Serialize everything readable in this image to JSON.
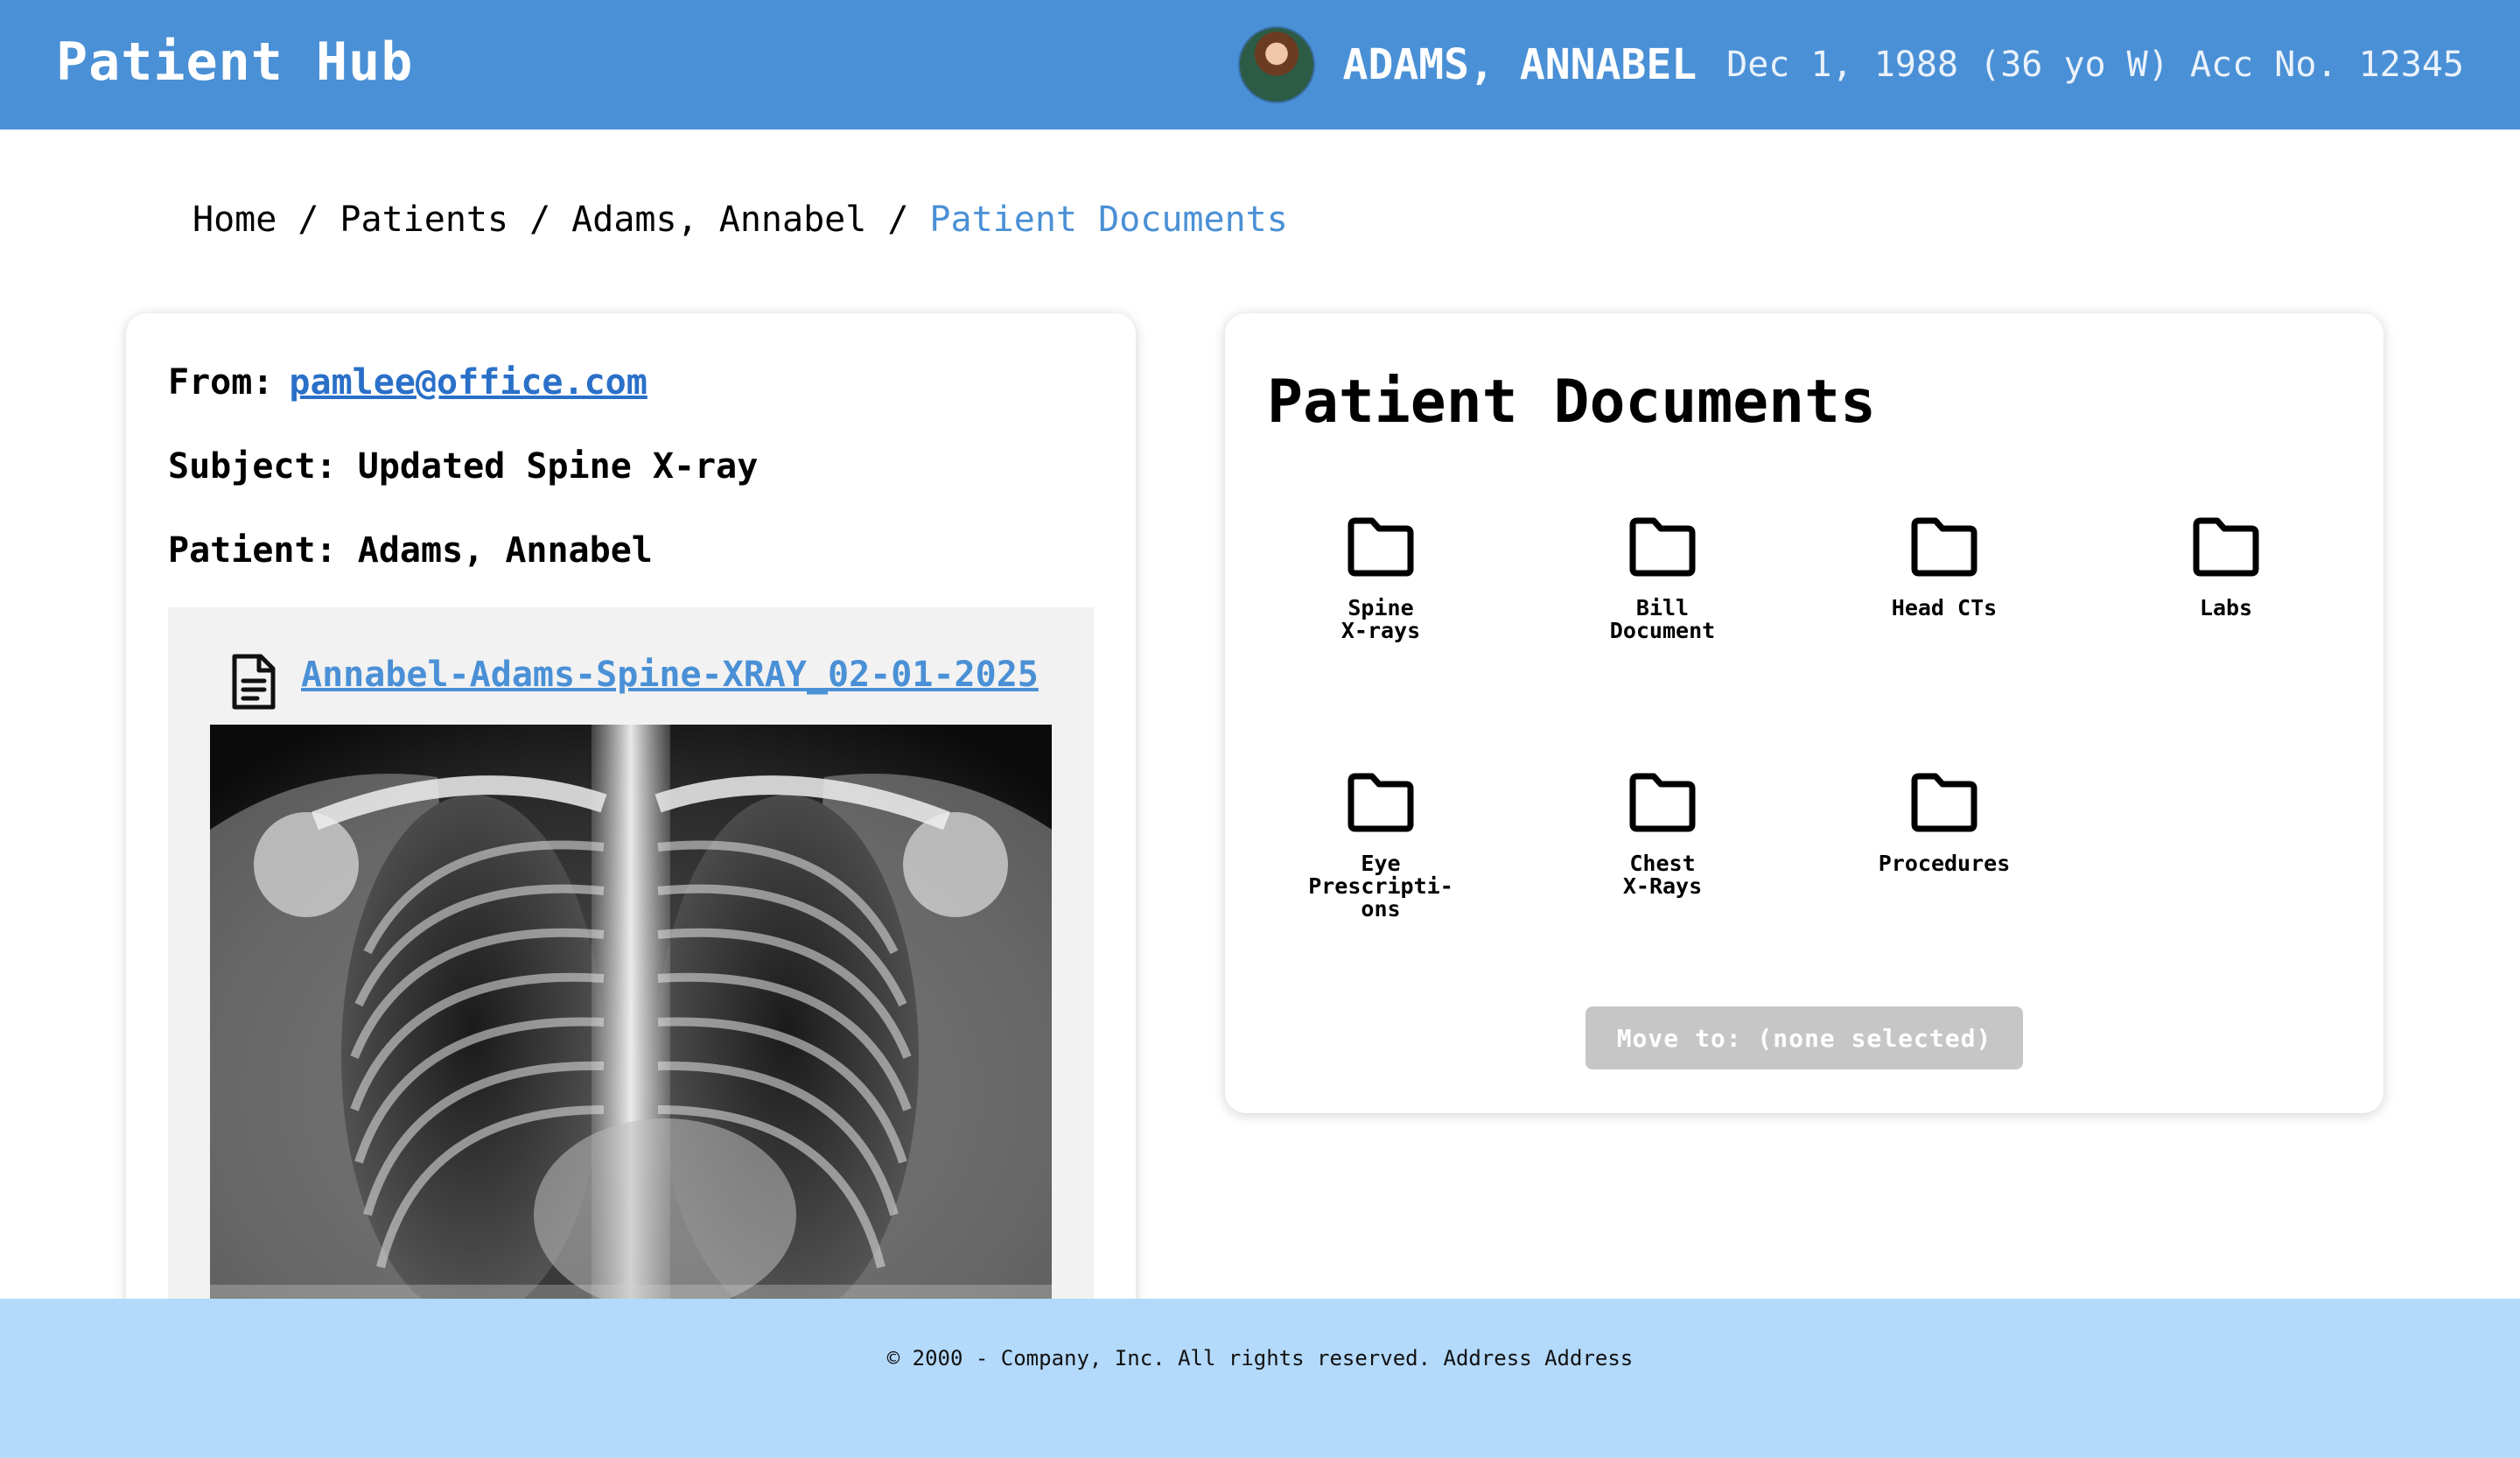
{
  "header": {
    "app_title": "Patient Hub",
    "patient_name": "ADAMS, ANNABEL",
    "patient_meta": "Dec 1, 1988 (36 yo W) Acc No. 12345"
  },
  "breadcrumb": {
    "items": [
      "Home",
      "Patients",
      "Adams, Annabel"
    ],
    "separator": "/",
    "current": "Patient Documents"
  },
  "email": {
    "from_label": "From:",
    "from_value": "pamlee@office.com",
    "subject": "Subject: Updated Spine X-ray",
    "patient": "Patient: Adams, Annabel",
    "attachment_name": "Annabel-Adams-Spine-XRAY_02-01-2025",
    "attachment_icon": "document-icon"
  },
  "documents": {
    "title": "Patient Documents",
    "folders": [
      {
        "label": "Spine\nX-rays"
      },
      {
        "label": "Bill\nDocument"
      },
      {
        "label": "Head CTs"
      },
      {
        "label": "Labs"
      },
      {
        "label": "Eye\nPrescripti-\nons"
      },
      {
        "label": "Chest\nX-Rays"
      },
      {
        "label": "Procedures"
      }
    ],
    "move_button": "Move to: (none selected)"
  },
  "footer": {
    "text": "© 2000 - Company, Inc. All rights reserved. Address Address"
  },
  "colors": {
    "header": "#4a90d6",
    "footer": "#b3d9fb",
    "link": "#2a70c8",
    "button_disabled": "#c6c6c6"
  }
}
